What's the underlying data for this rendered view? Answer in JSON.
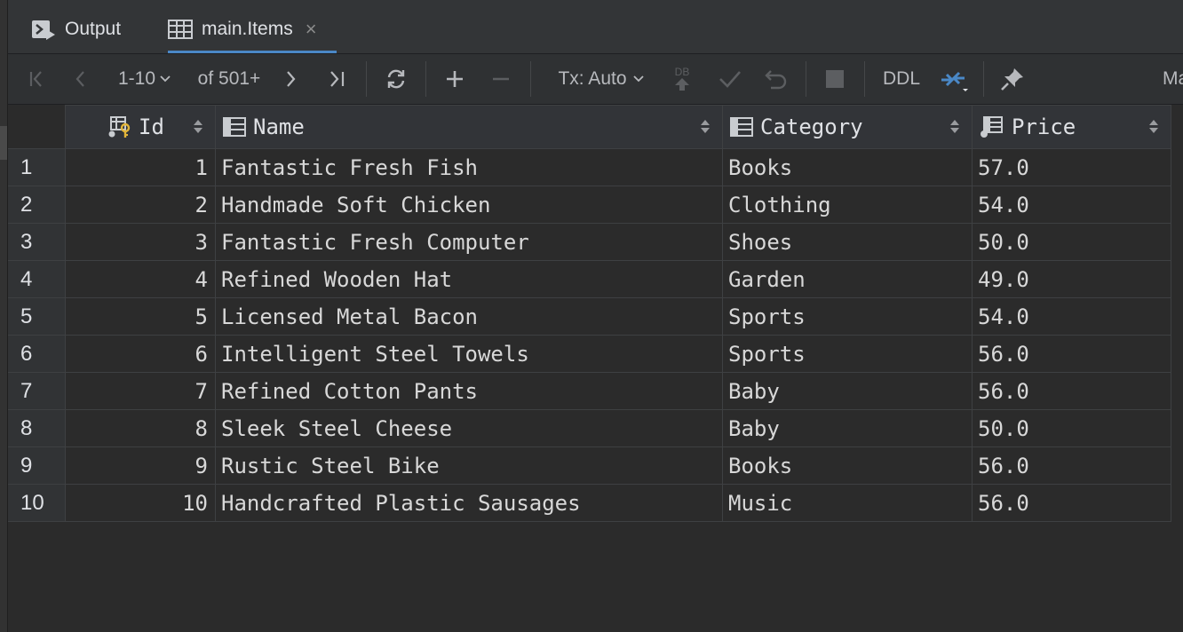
{
  "tabs": [
    {
      "label": "Output",
      "icon": "console-output-icon"
    },
    {
      "label": "main.Items",
      "icon": "table-icon",
      "close": "×"
    }
  ],
  "toolbar": {
    "page_range": "1-10",
    "of_total": "of 501+",
    "tx_mode": "Tx: Auto",
    "db_label": "DB",
    "ddl_label": "DDL",
    "cut_label": "Ma"
  },
  "table": {
    "columns": [
      "Id",
      "Name",
      "Category",
      "Price"
    ],
    "rows": [
      {
        "n": "1",
        "id": "1",
        "name": "Fantastic Fresh Fish",
        "category": "Books",
        "price": "57.0"
      },
      {
        "n": "2",
        "id": "2",
        "name": "Handmade Soft Chicken",
        "category": "Clothing",
        "price": "54.0"
      },
      {
        "n": "3",
        "id": "3",
        "name": "Fantastic Fresh Computer",
        "category": "Shoes",
        "price": "50.0"
      },
      {
        "n": "4",
        "id": "4",
        "name": "Refined Wooden Hat",
        "category": "Garden",
        "price": "49.0"
      },
      {
        "n": "5",
        "id": "5",
        "name": "Licensed Metal Bacon",
        "category": "Sports",
        "price": "54.0"
      },
      {
        "n": "6",
        "id": "6",
        "name": "Intelligent Steel Towels",
        "category": "Sports",
        "price": "56.0"
      },
      {
        "n": "7",
        "id": "7",
        "name": "Refined Cotton Pants",
        "category": "Baby",
        "price": "56.0"
      },
      {
        "n": "8",
        "id": "8",
        "name": "Sleek Steel Cheese",
        "category": "Baby",
        "price": "50.0"
      },
      {
        "n": "9",
        "id": "9",
        "name": "Rustic Steel Bike",
        "category": "Books",
        "price": "56.0"
      },
      {
        "n": "10",
        "id": "10",
        "name": "Handcrafted Plastic Sausages",
        "category": "Music",
        "price": "56.0"
      }
    ]
  },
  "colors": {
    "accent": "#4a88c7",
    "key": "#e2b53a",
    "background": "#2b2b2b"
  }
}
